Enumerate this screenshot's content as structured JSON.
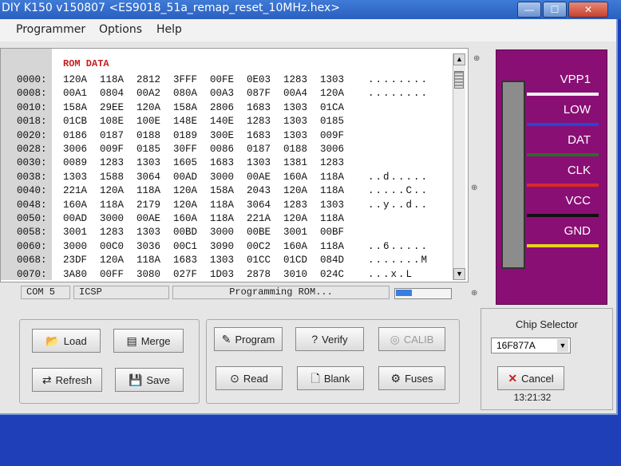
{
  "window": {
    "title": "DIY K150 v150807 <ES9018_51a_remap_reset_10MHz.hex>",
    "minimize": "—",
    "maximize": "☐",
    "close": "✕"
  },
  "menu": [
    "Programmer",
    "Options",
    "Help"
  ],
  "rom": {
    "title": "ROM DATA",
    "rows": [
      {
        "addr": "0000:",
        "words": [
          "120A",
          "118A",
          "2812",
          "3FFF",
          "00FE",
          "0E03",
          "1283",
          "1303"
        ],
        "ascii": "........"
      },
      {
        "addr": "0008:",
        "words": [
          "00A1",
          "0804",
          "00A2",
          "080A",
          "00A3",
          "087F",
          "00A4",
          "120A"
        ],
        "ascii": "........"
      },
      {
        "addr": "0010:",
        "words": [
          "158A",
          "29EE",
          "120A",
          "158A",
          "2806",
          "1683",
          "1303",
          "01CA"
        ],
        "ascii": ""
      },
      {
        "addr": "0018:",
        "words": [
          "01CB",
          "108E",
          "100E",
          "148E",
          "140E",
          "1283",
          "1303",
          "0185"
        ],
        "ascii": ""
      },
      {
        "addr": "0020:",
        "words": [
          "0186",
          "0187",
          "0188",
          "0189",
          "300E",
          "1683",
          "1303",
          "009F"
        ],
        "ascii": ""
      },
      {
        "addr": "0028:",
        "words": [
          "3006",
          "009F",
          "0185",
          "30FF",
          "0086",
          "0187",
          "0188",
          "3006"
        ],
        "ascii": ""
      },
      {
        "addr": "0030:",
        "words": [
          "0089",
          "1283",
          "1303",
          "1605",
          "1683",
          "1303",
          "1381",
          "1283"
        ],
        "ascii": ""
      },
      {
        "addr": "0038:",
        "words": [
          "1303",
          "1588",
          "3064",
          "00AD",
          "3000",
          "00AE",
          "160A",
          "118A"
        ],
        "ascii": "..d....."
      },
      {
        "addr": "0040:",
        "words": [
          "221A",
          "120A",
          "118A",
          "120A",
          "158A",
          "2043",
          "120A",
          "118A"
        ],
        "ascii": ".....C.."
      },
      {
        "addr": "0048:",
        "words": [
          "160A",
          "118A",
          "2179",
          "120A",
          "118A",
          "3064",
          "1283",
          "1303"
        ],
        "ascii": "..y..d.."
      },
      {
        "addr": "0050:",
        "words": [
          "00AD",
          "3000",
          "00AE",
          "160A",
          "118A",
          "221A",
          "120A",
          "118A"
        ],
        "ascii": ""
      },
      {
        "addr": "0058:",
        "words": [
          "3001",
          "1283",
          "1303",
          "00BD",
          "3000",
          "00BE",
          "3001",
          "00BF"
        ],
        "ascii": ""
      },
      {
        "addr": "0060:",
        "words": [
          "3000",
          "00C0",
          "3036",
          "00C1",
          "3090",
          "00C2",
          "160A",
          "118A"
        ],
        "ascii": "..6....."
      },
      {
        "addr": "0068:",
        "words": [
          "23DF",
          "120A",
          "118A",
          "1683",
          "1303",
          "01CC",
          "01CD",
          "084D"
        ],
        "ascii": ".......M"
      },
      {
        "addr": "0070:",
        "words": [
          "3A80",
          "00FF",
          "3080",
          "027F",
          "1D03",
          "2878",
          "3010",
          "024C"
        ],
        "ascii": "...x.L"
      }
    ]
  },
  "status": {
    "port": "COM 5",
    "mode": "ICSP",
    "message": "Programming ROM...",
    "progress": 0.3
  },
  "pins": [
    {
      "label": "VPP1",
      "color": "#f2f2f2"
    },
    {
      "label": "LOW",
      "color": "#2746d8"
    },
    {
      "label": "DAT",
      "color": "#2f6a2a"
    },
    {
      "label": "CLK",
      "color": "#d82a2a"
    },
    {
      "label": "VCC",
      "color": "#111111"
    },
    {
      "label": "GND",
      "color": "#e8d21a"
    }
  ],
  "buttons": {
    "load": "Load",
    "merge": "Merge",
    "refresh": "Refresh",
    "save": "Save",
    "program": "Program",
    "verify": "Verify",
    "calib": "CALIB",
    "read": "Read",
    "blank": "Blank",
    "fuses": "Fuses"
  },
  "chip_selector": {
    "title": "Chip Selector",
    "selected": "16F877A",
    "cancel": "Cancel",
    "time": "13:21:32"
  }
}
